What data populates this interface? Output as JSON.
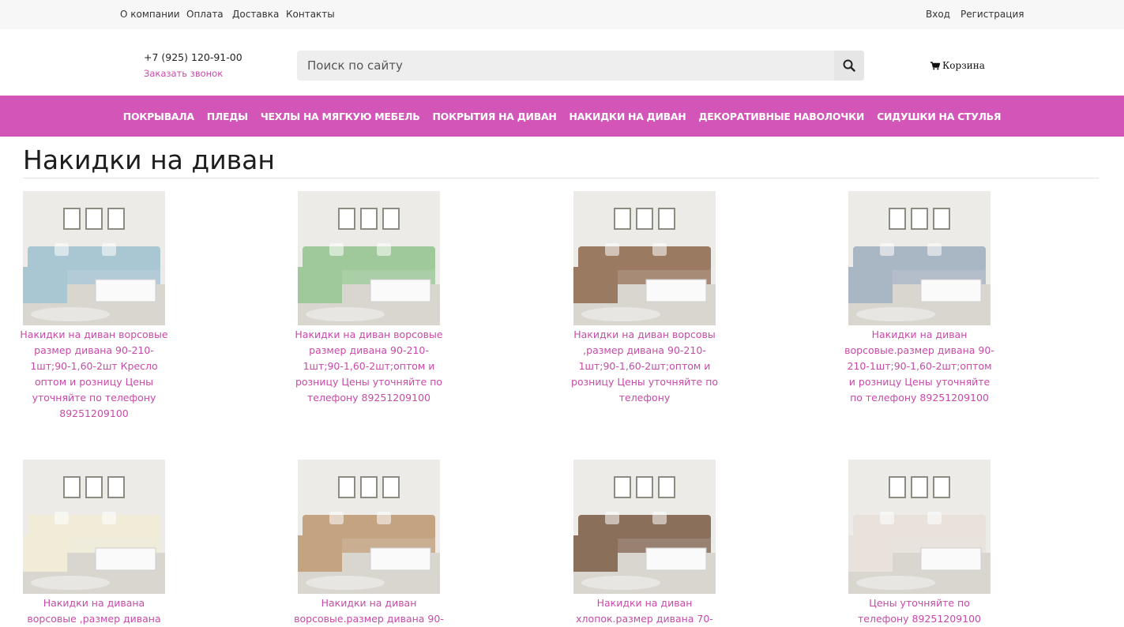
{
  "topbar": {
    "links": [
      "О компании",
      "Оплата",
      "Доставка",
      "Контакты"
    ],
    "login": "Вход",
    "register": "Регистрация"
  },
  "header": {
    "phone": "+7 (925) 120-91-00",
    "callback": "Заказать звонок",
    "search_placeholder": "Поиск по сайту",
    "cart": "Корзина"
  },
  "nav": {
    "items": [
      "Покрывала",
      "Пледы",
      "Чехлы на мягкую мебель",
      "Покрытия на диван",
      "Накидки на диван",
      "Декоративные наволочки",
      "Сидушки на стулья"
    ]
  },
  "page": {
    "title": "Накидки на диван"
  },
  "products": [
    {
      "title": "Накидки на диван ворсовые размер дивана 90-210-1шт;90-1,60-2шт Кресло оптом и розницу Цены уточняйте по телефону 89251209100",
      "color": "#a9c6d3"
    },
    {
      "title": "Накидки на диван ворсовые размер дивана 90-210-1шт;90-1,60-2шт;оптом и розницу Цены уточняйте по телефону 89251209100",
      "color": "#9fc99a"
    },
    {
      "title": "Накидки на диван ворсовы ,размер дивана 90-210-1шт;90-1,60-2шт;оптом и розницу Цены уточняйте по телефону",
      "color": "#9b7a62"
    },
    {
      "title": "Накидки на диван ворсовые.размер дивана 90-210-1шт;90-1,60-2шт;оптом и розницу Цены уточняйте по телефону 89251209100",
      "color": "#a9b6c4"
    },
    {
      "title": "Накидки на дивана ворсовые ,размер дивана",
      "color": "#f0ecd8"
    },
    {
      "title": "Накидки на диван ворсовые.размер дивана 90-",
      "color": "#c4a381"
    },
    {
      "title": "Накидки на диван хлопок.размер дивана 70-",
      "color": "#8a6f5a"
    },
    {
      "title": "Цены уточняйте по телефону 89251209100",
      "color": "#e9e2dc"
    }
  ]
}
